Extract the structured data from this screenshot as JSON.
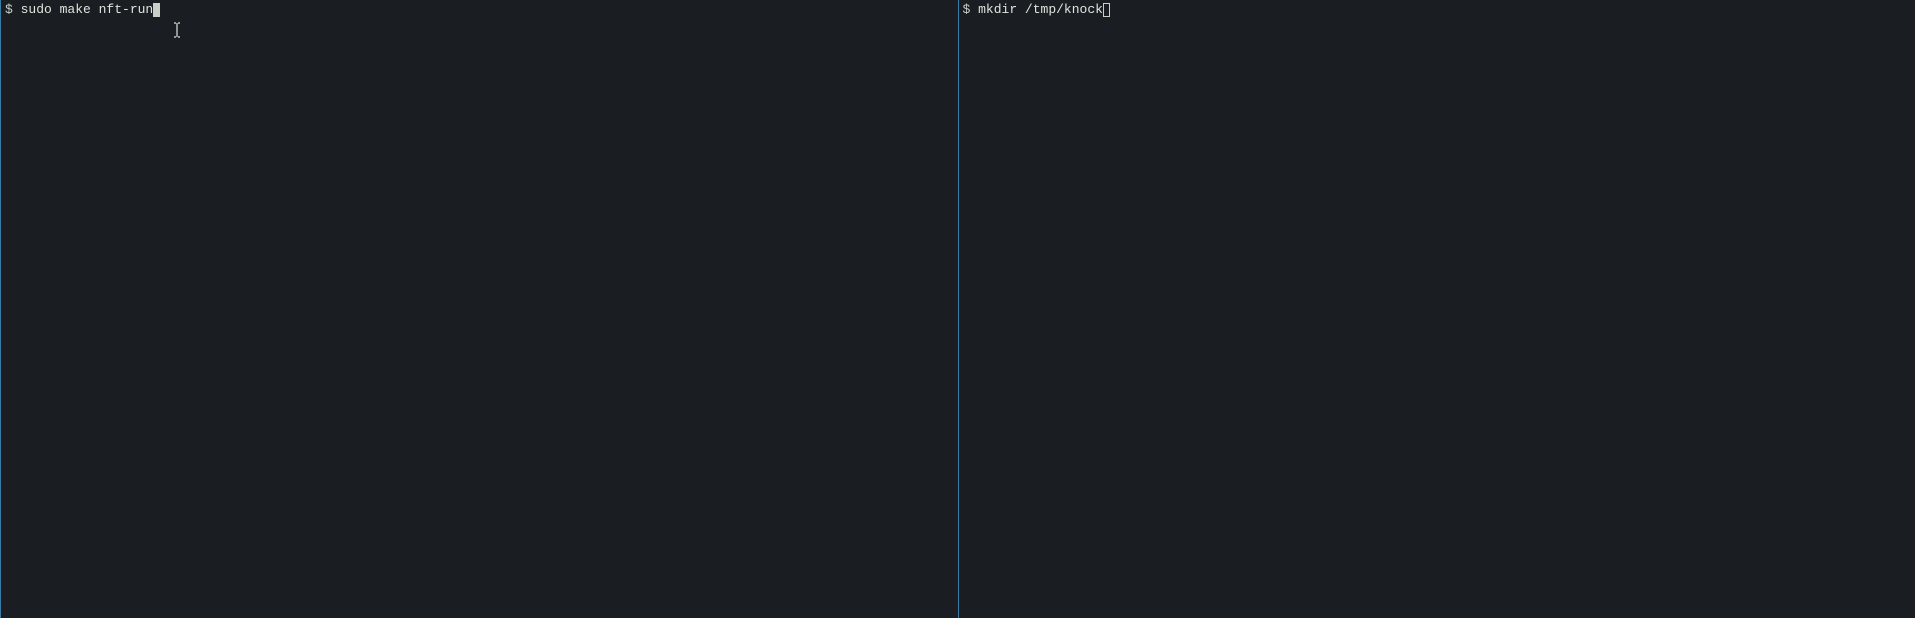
{
  "left_pane": {
    "prompt": "$ ",
    "command": "sudo make nft-run",
    "cursor_type": "block"
  },
  "right_pane": {
    "prompt": "$ ",
    "command": "mkdir /tmp/knock",
    "cursor_type": "outline"
  }
}
